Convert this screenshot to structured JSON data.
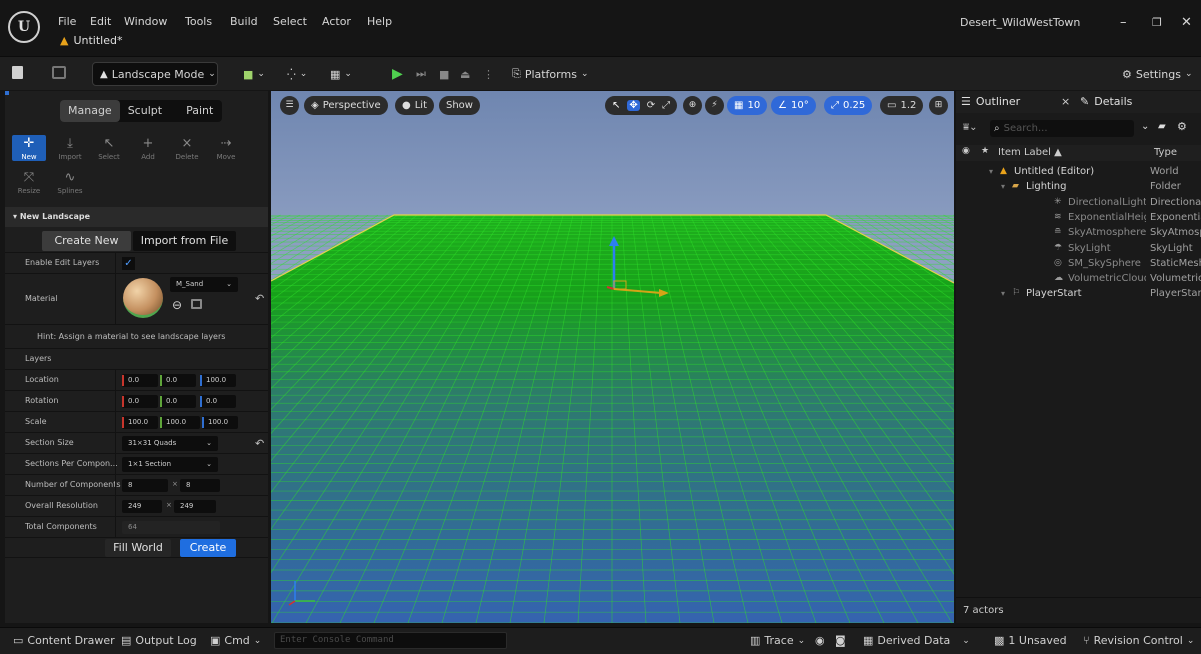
{
  "titlebar": {
    "project_name": "Desert_WildWestTown",
    "level_tab": "Untitled*",
    "menu": [
      "File",
      "Edit",
      "Window",
      "Tools",
      "Build",
      "Select",
      "Actor",
      "Help"
    ]
  },
  "toolbar": {
    "mode_label": "Landscape Mode",
    "platforms_label": "Platforms",
    "settings_label": "Settings"
  },
  "landscape": {
    "tabs": [
      "Manage",
      "Sculpt",
      "Paint"
    ],
    "tools": [
      {
        "label": "New",
        "icon": "new-landscape-icon"
      },
      {
        "label": "Import",
        "icon": "import-icon"
      },
      {
        "label": "Select",
        "icon": "select-icon"
      },
      {
        "label": "Add",
        "icon": "add-icon"
      },
      {
        "label": "Delete",
        "icon": "delete-icon"
      },
      {
        "label": "Move",
        "icon": "move-icon"
      },
      {
        "label": "Resize",
        "icon": "resize-icon"
      },
      {
        "label": "Splines",
        "icon": "splines-icon"
      }
    ],
    "section_title": "New Landscape",
    "create_new_label": "Create New",
    "import_from_file_label": "Import from File",
    "enable_edit_layers_label": "Enable Edit Layers",
    "material_label": "Material",
    "material_name": "M_Sand",
    "hint": "Hint: Assign a material to see landscape layers",
    "layers_label": "Layers",
    "location_label": "Location",
    "location": [
      "0.0",
      "0.0",
      "100.0"
    ],
    "rotation_label": "Rotation",
    "rotation": [
      "0.0",
      "0.0",
      "0.0"
    ],
    "scale_label": "Scale",
    "scale": [
      "100.0",
      "100.0",
      "100.0"
    ],
    "section_size_label": "Section Size",
    "section_size": "31×31 Quads",
    "sections_per_component_label": "Sections Per Compon...",
    "sections_per_component": "1×1 Section",
    "number_of_components_label": "Number of Components",
    "number_of_components": [
      "8",
      "8"
    ],
    "overall_resolution_label": "Overall Resolution",
    "overall_resolution": [
      "249",
      "249"
    ],
    "total_components_label": "Total Components",
    "total_components": "64",
    "fill_world_label": "Fill World",
    "create_label": "Create"
  },
  "viewport": {
    "perspective_label": "Perspective",
    "lit_label": "Lit",
    "show_label": "Show",
    "grid_snap": "10",
    "rotation_snap": "10°",
    "scale_snap": "0.25",
    "camera_speed": "1.2"
  },
  "outliner": {
    "tab_label": "Outliner",
    "details_label": "Details",
    "search_placeholder": "Search...",
    "col_label": "Item Label ▲",
    "col_type": "Type",
    "rows": [
      {
        "label": "Untitled (Editor)",
        "type": "World",
        "indent": 0,
        "icon": "world-icon"
      },
      {
        "label": "Lighting",
        "type": "Folder",
        "indent": 1,
        "icon": "folder-icon"
      },
      {
        "label": "DirectionalLight",
        "type": "Directional",
        "indent": 2,
        "icon": "directional-light-icon"
      },
      {
        "label": "ExponentialHeightF",
        "type": "Exponentia",
        "indent": 2,
        "icon": "fog-icon"
      },
      {
        "label": "SkyAtmosphere",
        "type": "SkyAtmosp",
        "indent": 2,
        "icon": "sky-atmosphere-icon"
      },
      {
        "label": "SkyLight",
        "type": "SkyLight",
        "indent": 2,
        "icon": "sky-light-icon"
      },
      {
        "label": "SM_SkySphere",
        "type": "StaticMesh",
        "indent": 2,
        "icon": "static-mesh-icon"
      },
      {
        "label": "VolumetricCloud",
        "type": "Volumetric",
        "indent": 2,
        "icon": "cloud-icon"
      },
      {
        "label": "PlayerStart",
        "type": "PlayerStart",
        "indent": 1,
        "icon": "player-start-icon"
      }
    ],
    "actor_count": "7 actors"
  },
  "statusbar": {
    "content_drawer": "Content Drawer",
    "output_log": "Output Log",
    "cmd": "Cmd",
    "console_placeholder": "Enter Console Command",
    "trace": "Trace",
    "derived_data": "Derived Data",
    "unsaved": "1 Unsaved",
    "revision_control": "Revision Control"
  },
  "colors": {
    "accent": "#1f5fb8",
    "landscape_green": "#19a81a",
    "sky_top": "#6f86b0",
    "sky_bottom": "#b5c4dc"
  }
}
